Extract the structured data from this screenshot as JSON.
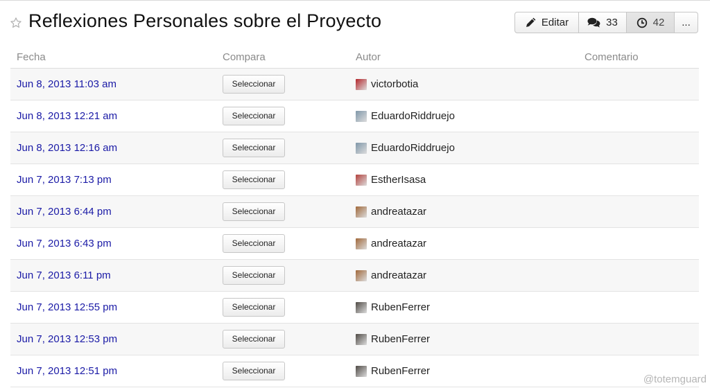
{
  "page": {
    "title": "Reflexiones Personales sobre el Proyecto"
  },
  "toolbar": {
    "edit_label": "Editar",
    "comments_count": "33",
    "history_count": "42",
    "more_label": "..."
  },
  "table": {
    "headers": [
      "Fecha",
      "Compara",
      "Autor",
      "Comentario"
    ],
    "rows": [
      {
        "date": "Jun 8, 2013 11:03 am",
        "button": "Seleccionar",
        "author": "victorbotia",
        "avatar": "avatar-victorbotia",
        "avatar_color": "#b3262b"
      },
      {
        "date": "Jun 8, 2013 12:21 am",
        "button": "Seleccionar",
        "author": "EduardoRiddruejo",
        "avatar": "avatar-eduardoriddruejo",
        "avatar_color": "#7f97a9"
      },
      {
        "date": "Jun 8, 2013 12:16 am",
        "button": "Seleccionar",
        "author": "EduardoRiddruejo",
        "avatar": "avatar-eduardoriddruejo",
        "avatar_color": "#7f97a9"
      },
      {
        "date": "Jun 7, 2013 7:13 pm",
        "button": "Seleccionar",
        "author": "EstherIsasa",
        "avatar": "avatar-estherisasa",
        "avatar_color": "#b3413d"
      },
      {
        "date": "Jun 7, 2013 6:44 pm",
        "button": "Seleccionar",
        "author": "andreatazar",
        "avatar": "avatar-andreatazar",
        "avatar_color": "#a0683a"
      },
      {
        "date": "Jun 7, 2013 6:43 pm",
        "button": "Seleccionar",
        "author": "andreatazar",
        "avatar": "avatar-andreatazar",
        "avatar_color": "#a0683a"
      },
      {
        "date": "Jun 7, 2013 6:11 pm",
        "button": "Seleccionar",
        "author": "andreatazar",
        "avatar": "avatar-andreatazar",
        "avatar_color": "#a0683a"
      },
      {
        "date": "Jun 7, 2013 12:55 pm",
        "button": "Seleccionar",
        "author": "RubenFerrer",
        "avatar": "avatar-rubenferrer",
        "avatar_color": "#4f4a45"
      },
      {
        "date": "Jun 7, 2013 12:53 pm",
        "button": "Seleccionar",
        "author": "RubenFerrer",
        "avatar": "avatar-rubenferrer",
        "avatar_color": "#4f4a45"
      },
      {
        "date": "Jun 7, 2013 12:51 pm",
        "button": "Seleccionar",
        "author": "RubenFerrer",
        "avatar": "avatar-rubenferrer",
        "avatar_color": "#4f4a45"
      }
    ]
  },
  "watermark": "@totemguard",
  "colors": {
    "link": "#1a1aa6",
    "header_text": "#8a8a8a",
    "row_alt": "#f7f7f7"
  },
  "icons": {
    "favorite": "star-icon",
    "edit": "pencil-icon",
    "comments": "comments-icon",
    "history": "clock-icon"
  }
}
